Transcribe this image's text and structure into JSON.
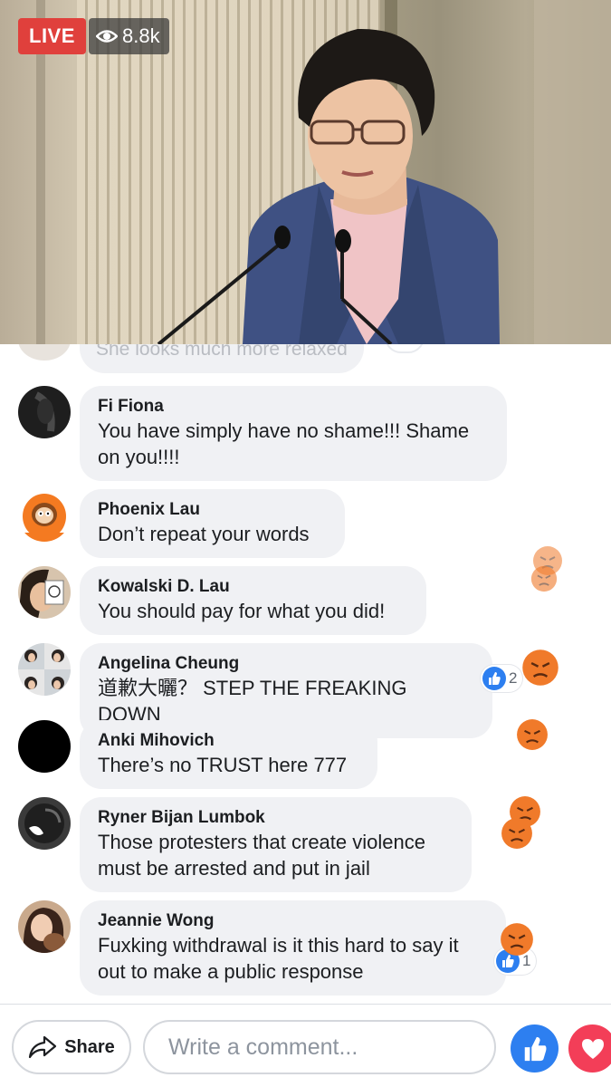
{
  "stream": {
    "live_label": "LIVE",
    "viewer_count": "8.8k"
  },
  "comments": {
    "partial": {
      "text": "She looks much more relaxed"
    },
    "items": [
      {
        "name": "Fi Fiona",
        "lines": [
          "You have simply have no shame!!! Shame",
          "on you!!!!"
        ]
      },
      {
        "name": "Phoenix Lau",
        "lines": [
          "Don’t repeat your words"
        ]
      },
      {
        "name": "Kowalski D. Lau",
        "lines": [
          "You should pay for what you did!"
        ]
      },
      {
        "name": "Angelina Cheung",
        "lines": [
          "道歉大曬？ STEP THE FREAKING DOWN"
        ],
        "likes": "2"
      },
      {
        "name": "Anki Mihovich",
        "lines": [
          "There’s no TRUST here 777"
        ]
      },
      {
        "name": "Ryner Bijan Lumbok",
        "lines": [
          "Those protesters that create violence",
          "must be arrested and put in jail"
        ]
      },
      {
        "name": "Jeannie Wong",
        "lines": [
          "Fuxking withdrawal is it this hard to say it",
          "out to make a public response"
        ],
        "likes": "1"
      }
    ]
  },
  "bottom_bar": {
    "share_label": "Share",
    "comment_placeholder": "Write a comment..."
  },
  "colors": {
    "live_red": "#e0403c",
    "like_blue": "#2d7ff0",
    "love_red": "#f33e58",
    "angry_orange": "#f07a2a"
  }
}
